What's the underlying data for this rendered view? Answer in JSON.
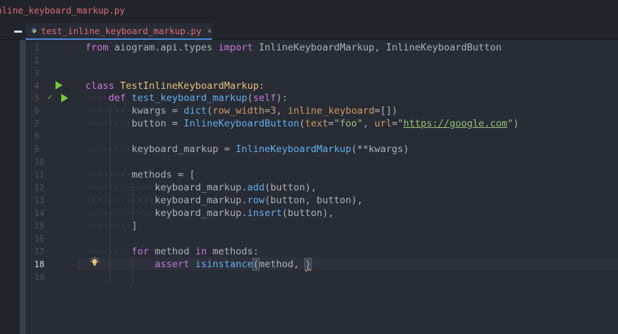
{
  "window": {
    "file_title": "nline_keyboard_markup.py"
  },
  "tab": {
    "label": "test_inline_keyboard_markup.py",
    "close": "×"
  },
  "icons": {
    "collapse": "minus-icon",
    "python": "python-icon",
    "run": "run-icon",
    "check": "check-icon",
    "bulb": "lightbulb-icon"
  },
  "colors": {
    "keyword": "#c678dd",
    "class": "#e5c07b",
    "function": "#61afef",
    "string": "#98c379",
    "number": "#d19a66",
    "run": "#73c936",
    "tab_label": "#e06c75"
  },
  "editor": {
    "current_line": 18,
    "line_numbers": [
      "1",
      "2",
      "3",
      "4",
      "5",
      "6",
      "7",
      "8",
      "9",
      "10",
      "11",
      "12",
      "13",
      "14",
      "15",
      "16",
      "17",
      "18",
      "19"
    ],
    "code": {
      "l1": {
        "from": "from",
        "module": " aiogram.api.types ",
        "import": "import",
        "names": " InlineKeyboardMarkup, InlineKeyboardButton"
      },
      "l4": {
        "class_kw": "class",
        "class_name": "TestInlineKeyboardMarkup",
        "colon": ":"
      },
      "l5": {
        "def_kw": "def",
        "fn_name": "test_keyboard_markup",
        "open": "(",
        "self": "self",
        "close": "):"
      },
      "l6": {
        "var": "kwargs = ",
        "dict": "dict",
        "open": "(",
        "p1": "row_width",
        "eq1": "=",
        "v1": "3",
        "sep": ", ",
        "p2": "inline_keyboard",
        "rest": "=[])"
      },
      "l7": {
        "var": "button = ",
        "cls": "InlineKeyboardButton",
        "open": "(",
        "p1": "text",
        "eq1": "=",
        "v1": "\"foo\"",
        "sep": ", ",
        "p2": "url",
        "eq2": "=",
        "q1": "\"",
        "url": "https://google.com",
        "q2": "\"",
        "close": ")"
      },
      "l9": {
        "var": "keyboard_markup = ",
        "cls": "InlineKeyboardMarkup",
        "args": "(**kwargs)"
      },
      "l11": {
        "text": "methods = ["
      },
      "l12": {
        "obj": "keyboard_markup.",
        "method": "add",
        "args": "(button),"
      },
      "l13": {
        "obj": "keyboard_markup.",
        "method": "row",
        "args": "(button, button),"
      },
      "l14": {
        "obj": "keyboard_markup.",
        "method": "insert",
        "args": "(button),"
      },
      "l15": {
        "text": "]"
      },
      "l17": {
        "for": "for",
        "var": " method ",
        "in": "in",
        "iter": " methods:"
      },
      "l18": {
        "assert": "assert",
        "sp": " ",
        "fn": "isinstance",
        "open": "(",
        "args": "method, ",
        "close": ")"
      }
    }
  }
}
